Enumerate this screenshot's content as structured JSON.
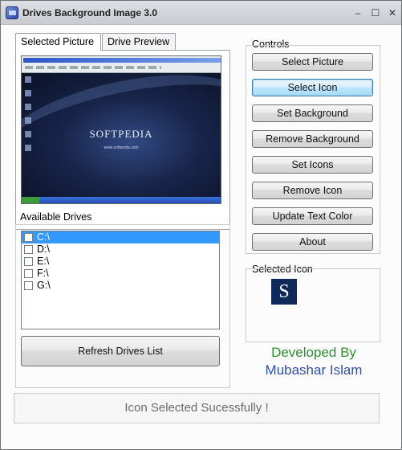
{
  "window": {
    "title": "Drives Background Image 3.0",
    "minimize_glyph": "–",
    "maximize_glyph": "☐",
    "close_glyph": "✕"
  },
  "tabs": [
    {
      "label": "Selected Picture",
      "active": true
    },
    {
      "label": "Drive Preview",
      "active": false
    }
  ],
  "preview": {
    "logo_text": "SOFTPEDIA",
    "url_text": "www.softpedia.com"
  },
  "drives": {
    "group_label": "Available Drives",
    "items": [
      {
        "label": "C:\\",
        "checked": false,
        "selected": true
      },
      {
        "label": "D:\\",
        "checked": false,
        "selected": false
      },
      {
        "label": "E:\\",
        "checked": false,
        "selected": false
      },
      {
        "label": "F:\\",
        "checked": false,
        "selected": false
      },
      {
        "label": "G:\\",
        "checked": false,
        "selected": false
      }
    ],
    "refresh_label": "Refresh Drives List"
  },
  "controls": {
    "group_label": "Controls",
    "buttons": [
      {
        "label": "Select Picture"
      },
      {
        "label": "Select Icon"
      },
      {
        "label": "Set Background"
      },
      {
        "label": "Remove Background"
      },
      {
        "label": "Set Icons"
      },
      {
        "label": "Remove Icon"
      },
      {
        "label": "Update Text Color"
      },
      {
        "label": "About"
      }
    ]
  },
  "selected_icon": {
    "group_label": "Selected Icon",
    "glyph": "S"
  },
  "credits": {
    "line1": "Developed By",
    "line2": "Mubashar Islam"
  },
  "status": {
    "text": "Icon Selected Sucessfully !"
  },
  "colors": {
    "selection": "#3399ff",
    "developed_by": "#2f8c2f",
    "author": "#2f4fa0"
  }
}
